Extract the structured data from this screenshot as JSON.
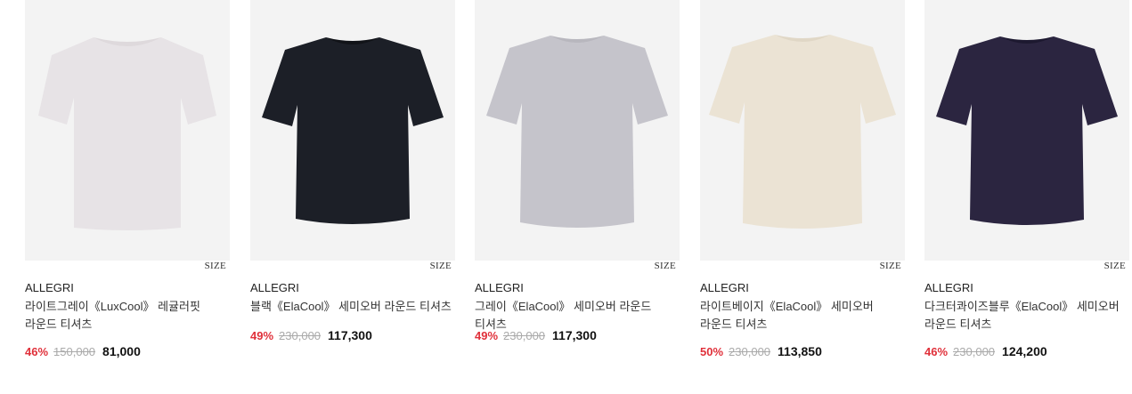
{
  "products": [
    {
      "brand": "ALLEGRI",
      "name": "라이트그레이《LuxCool》 레귤러핏 라운드 티셔츠",
      "discount": "46%",
      "original_price": "150,000",
      "sale_price": "81,000",
      "size_label": "SIZE",
      "shirt_color": "#e7e3e6",
      "collar_color": "#ded9dc"
    },
    {
      "brand": "ALLEGRI",
      "name": "블랙《ElaCool》 세미오버 라운드 티셔츠",
      "discount": "49%",
      "original_price": "230,000",
      "sale_price": "117,300",
      "size_label": "SIZE",
      "shirt_color": "#1c1f27",
      "collar_color": "#111318"
    },
    {
      "brand": "ALLEGRI",
      "name": "그레이《ElaCool》 세미오버 라운드 티셔츠",
      "discount": "49%",
      "original_price": "230,000",
      "sale_price": "117,300",
      "size_label": "SIZE",
      "shirt_color": "#c5c4cb",
      "collar_color": "#b8b7be"
    },
    {
      "brand": "ALLEGRI",
      "name": "라이트베이지《ElaCool》 세미오버 라운드 티셔츠",
      "discount": "50%",
      "original_price": "230,000",
      "sale_price": "113,850",
      "size_label": "SIZE",
      "shirt_color": "#ebe3d4",
      "collar_color": "#e0d7c6"
    },
    {
      "brand": "ALLEGRI",
      "name": "다크터콰이즈블루《ElaCool》 세미오버 라운드 티셔츠",
      "discount": "46%",
      "original_price": "230,000",
      "sale_price": "124,200",
      "size_label": "SIZE",
      "shirt_color": "#2b2540",
      "collar_color": "#1d1930"
    }
  ]
}
